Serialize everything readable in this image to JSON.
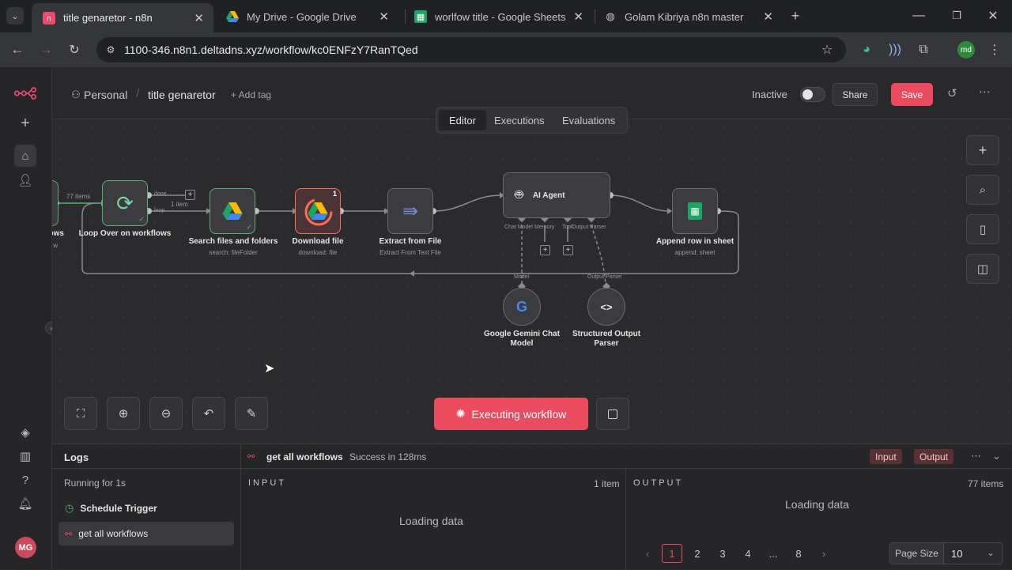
{
  "browser": {
    "tabs": [
      {
        "title": "title genaretor - n8n",
        "active": true
      },
      {
        "title": "My Drive - Google Drive",
        "active": false
      },
      {
        "title": "worlfow title - Google Sheets",
        "active": false
      },
      {
        "title": "Golam Kibriya n8n master",
        "active": false
      }
    ],
    "url": "1100-346.n8n1.deltadns.xyz/workflow/kc0ENFzY7RanTQed",
    "profile_initials": "md"
  },
  "header": {
    "project": "Personal",
    "workflow_name": "title genaretor",
    "add_tag": "+ Add tag",
    "status": "Inactive",
    "share_label": "Share",
    "save_label": "Save",
    "view_tabs": [
      "Editor",
      "Executions",
      "Evaluations"
    ]
  },
  "canvas": {
    "nodes": {
      "prev_title": "ows",
      "prev_sub": "w",
      "loop_title": "Loop Over on workflows",
      "search_title": "Search files and folders",
      "search_sub": "search: fileFolder",
      "download_title": "Download file",
      "download_sub": "download: file",
      "download_badge": "1",
      "extract_title": "Extract from File",
      "extract_sub": "Extract From Text File",
      "agent_title": "AI Agent",
      "append_title": "Append row in sheet",
      "append_sub": "append: sheet",
      "gemini_title_1": "Google Gemini Chat",
      "gemini_title_2": "Model",
      "parser_title_1": "Structured Output",
      "parser_title_2": "Parser"
    },
    "edge_labels": {
      "items_77": "77 items",
      "done": "done",
      "loop": "loop",
      "item_1": "1 item"
    },
    "agent_ports": {
      "chat_model": "Chat Model",
      "memory": "Memory",
      "tool": "Tool",
      "output_parser": "Output Parser"
    },
    "sub_labels": {
      "model": "Model",
      "output_parser": "Output Parser"
    },
    "execute_button": "Executing workflow"
  },
  "logs": {
    "title": "Logs",
    "running": "Running for 1s",
    "items": [
      "Schedule Trigger",
      "get all workflows"
    ],
    "selected_node": "get all workflows",
    "selected_status": "Success in 128ms",
    "input_btn": "Input",
    "output_btn": "Output",
    "input_label": "INPUT",
    "input_count": "1 item",
    "output_label": "OUTPUT",
    "output_count": "77 items",
    "loading_input": "Loading data",
    "loading_output": "Loading data",
    "pages": [
      "1",
      "2",
      "3",
      "4",
      "...",
      "8"
    ],
    "page_size_label": "Page Size",
    "page_size_value": "10",
    "user_initials": "MG"
  },
  "colors": {
    "accent": "#ff6d5a",
    "success": "#56b07a",
    "save": "#ea4b5f"
  }
}
